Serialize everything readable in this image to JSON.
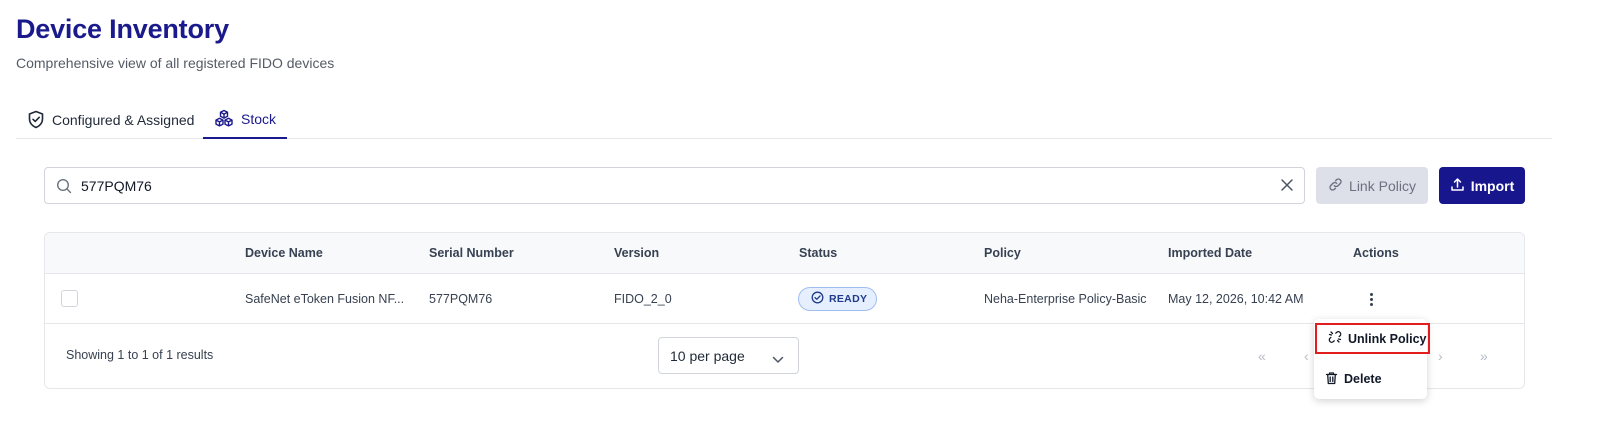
{
  "header": {
    "title": "Device Inventory",
    "subtitle": "Comprehensive view of all registered FIDO devices"
  },
  "tabs": [
    {
      "label": "Configured & Assigned",
      "icon": "shield-check-icon",
      "active": false
    },
    {
      "label": "Stock",
      "icon": "cubes-icon",
      "active": true
    }
  ],
  "search": {
    "value": "577PQM76",
    "placeholder": ""
  },
  "toolbar": {
    "link_policy_label": "Link Policy",
    "import_label": "Import"
  },
  "table": {
    "columns": [
      "Device Name",
      "Serial Number",
      "Version",
      "Status",
      "Policy",
      "Imported Date",
      "Actions"
    ],
    "rows": [
      {
        "device_name": "SafeNet eToken Fusion NF...",
        "serial_number": "577PQM76",
        "version": "FIDO_2_0",
        "status": "READY",
        "policy": "Neha-Enterprise Policy-Basic",
        "imported_date": "May 12, 2026, 10:42 AM"
      }
    ]
  },
  "footer": {
    "showing": "Showing 1 to 1 of 1 results",
    "per_page": "10 per page",
    "pager": {
      "first": "«",
      "prev": "‹",
      "next": "›",
      "last": "»"
    }
  },
  "action_menu": {
    "unlink_policy": "Unlink Policy",
    "delete": "Delete"
  },
  "colors": {
    "brand": "#1a1a8c",
    "primary_button": "#17168c",
    "highlight": "#e11d1d",
    "status_bg": "#e6efff"
  }
}
